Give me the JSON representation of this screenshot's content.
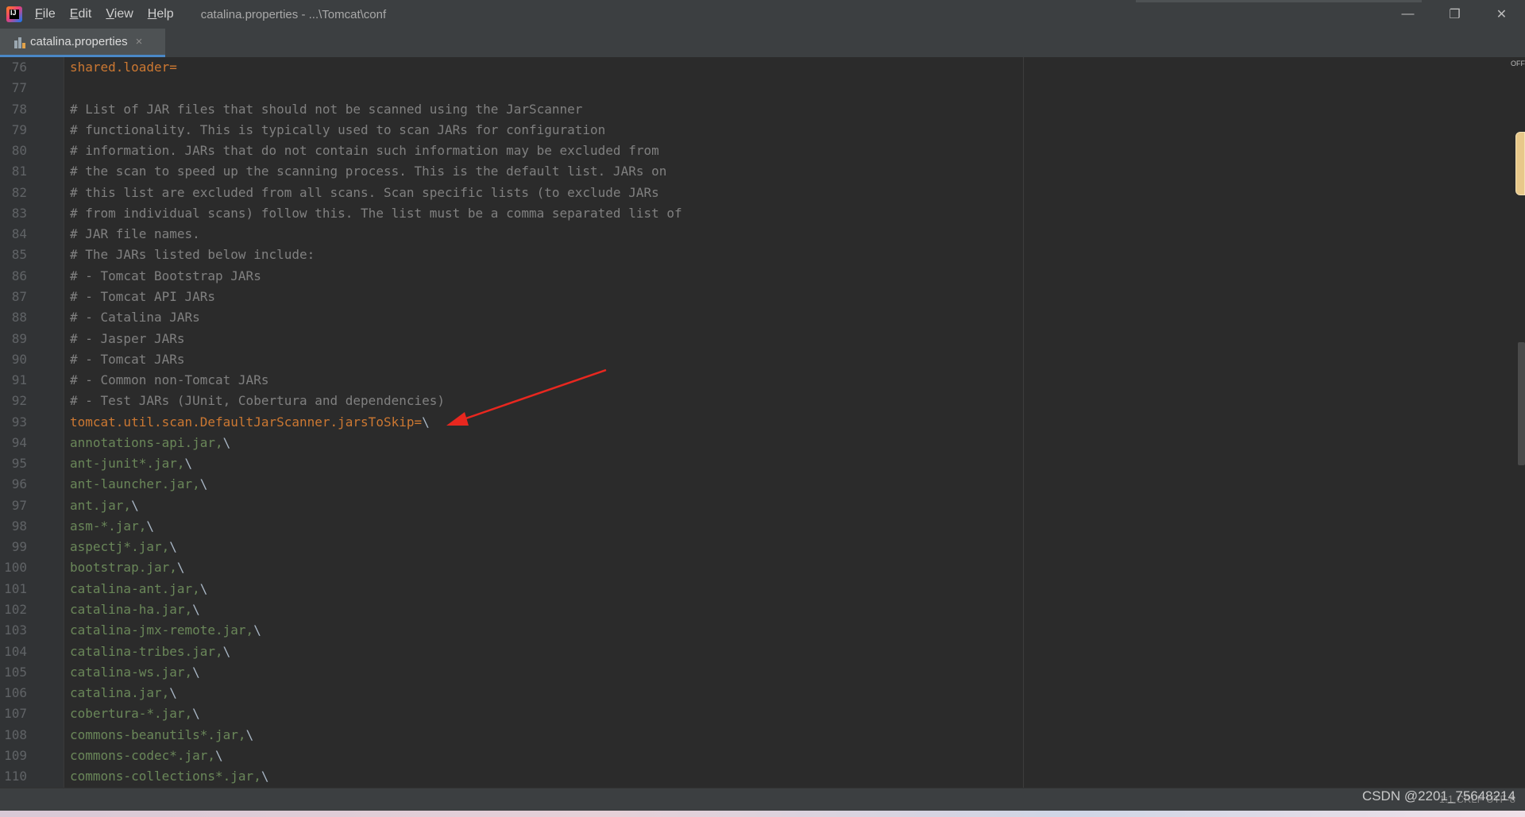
{
  "app": {
    "logo_text": "IJ",
    "window_title": "catalina.properties - ...\\Tomcat\\conf"
  },
  "menu": [
    {
      "label": "File",
      "mnemonic": "F",
      "rest": "ile"
    },
    {
      "label": "Edit",
      "mnemonic": "E",
      "rest": "dit"
    },
    {
      "label": "View",
      "mnemonic": "V",
      "rest": "iew"
    },
    {
      "label": "Help",
      "mnemonic": "H",
      "rest": "elp"
    }
  ],
  "window_controls": {
    "minimize": "—",
    "restore": "❐",
    "close": "✕"
  },
  "tabs": [
    {
      "label": "catalina.properties",
      "close": "×"
    }
  ],
  "editor": {
    "off_label": "OFF",
    "lines": [
      {
        "n": "76",
        "kind": "key",
        "key": "shared.loader",
        "eq": "=",
        "val": "",
        "bs": ""
      },
      {
        "n": "77",
        "kind": "blank",
        "text": ""
      },
      {
        "n": "78",
        "kind": "comment",
        "text": "# List of JAR files that should not be scanned using the JarScanner"
      },
      {
        "n": "79",
        "kind": "comment",
        "text": "# functionality. This is typically used to scan JARs for configuration"
      },
      {
        "n": "80",
        "kind": "comment",
        "text": "# information. JARs that do not contain such information may be excluded from"
      },
      {
        "n": "81",
        "kind": "comment",
        "text": "# the scan to speed up the scanning process. This is the default list. JARs on"
      },
      {
        "n": "82",
        "kind": "comment",
        "text": "# this list are excluded from all scans. Scan specific lists (to exclude JARs"
      },
      {
        "n": "83",
        "kind": "comment",
        "text": "# from individual scans) follow this. The list must be a comma separated list of"
      },
      {
        "n": "84",
        "kind": "comment",
        "text": "# JAR file names."
      },
      {
        "n": "85",
        "kind": "comment",
        "text": "# The JARs listed below include:"
      },
      {
        "n": "86",
        "kind": "comment",
        "text": "# - Tomcat Bootstrap JARs"
      },
      {
        "n": "87",
        "kind": "comment",
        "text": "# - Tomcat API JARs"
      },
      {
        "n": "88",
        "kind": "comment",
        "text": "# - Catalina JARs"
      },
      {
        "n": "89",
        "kind": "comment",
        "text": "# - Jasper JARs"
      },
      {
        "n": "90",
        "kind": "comment",
        "text": "# - Tomcat JARs"
      },
      {
        "n": "91",
        "kind": "comment",
        "text": "# - Common non-Tomcat JARs"
      },
      {
        "n": "92",
        "kind": "comment",
        "text": "# - Test JARs (JUnit, Cobertura and dependencies)"
      },
      {
        "n": "93",
        "kind": "key",
        "key": "tomcat.util.scan.DefaultJarScanner.jarsToSkip",
        "eq": "=",
        "val": "",
        "bs": "\\"
      },
      {
        "n": "94",
        "kind": "value",
        "val": "annotations-api.jar,",
        "bs": "\\"
      },
      {
        "n": "95",
        "kind": "value",
        "val": "ant-junit*.jar,",
        "bs": "\\"
      },
      {
        "n": "96",
        "kind": "value",
        "val": "ant-launcher.jar,",
        "bs": "\\"
      },
      {
        "n": "97",
        "kind": "value",
        "val": "ant.jar,",
        "bs": "\\"
      },
      {
        "n": "98",
        "kind": "value",
        "val": "asm-*.jar,",
        "bs": "\\"
      },
      {
        "n": "99",
        "kind": "value",
        "val": "aspectj*.jar,",
        "bs": "\\"
      },
      {
        "n": "100",
        "kind": "value",
        "val": "bootstrap.jar,",
        "bs": "\\"
      },
      {
        "n": "101",
        "kind": "value",
        "val": "catalina-ant.jar,",
        "bs": "\\"
      },
      {
        "n": "102",
        "kind": "value",
        "val": "catalina-ha.jar,",
        "bs": "\\"
      },
      {
        "n": "103",
        "kind": "value",
        "val": "catalina-jmx-remote.jar,",
        "bs": "\\"
      },
      {
        "n": "104",
        "kind": "value",
        "val": "catalina-tribes.jar,",
        "bs": "\\"
      },
      {
        "n": "105",
        "kind": "value",
        "val": "catalina-ws.jar,",
        "bs": "\\"
      },
      {
        "n": "106",
        "kind": "value",
        "val": "catalina.jar,",
        "bs": "\\"
      },
      {
        "n": "107",
        "kind": "value",
        "val": "cobertura-*.jar,",
        "bs": "\\"
      },
      {
        "n": "108",
        "kind": "value",
        "val": "commons-beanutils*.jar,",
        "bs": "\\"
      },
      {
        "n": "109",
        "kind": "value",
        "val": "commons-codec*.jar,",
        "bs": "\\"
      },
      {
        "n": "110",
        "kind": "value",
        "val": "commons-collections*.jar,",
        "bs": "\\"
      }
    ]
  },
  "status": {
    "position": "1:1  CRLF  UTF-8",
    "watermark": "CSDN @2201_75648214"
  },
  "colors": {
    "background": "#2b2b2b",
    "comment": "#808080",
    "key": "#cc7832",
    "value": "#6a8759",
    "annotation_arrow": "#e8271f"
  }
}
